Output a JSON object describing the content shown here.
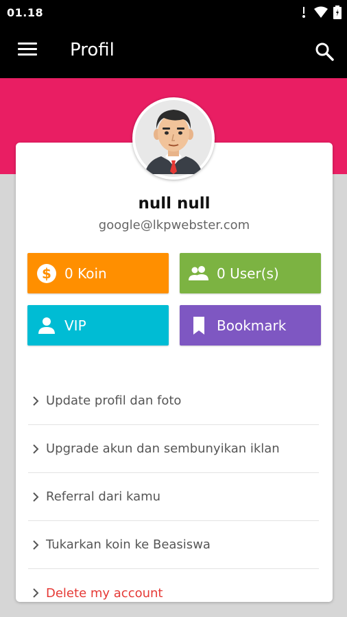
{
  "status_bar": {
    "time": "01.18",
    "icons": [
      "notification-icon",
      "wifi-icon",
      "battery-icon"
    ]
  },
  "app_bar": {
    "title": "Profil",
    "menu_icon": "hamburger-menu-icon",
    "search_icon": "search-icon"
  },
  "colors": {
    "banner": "#e91e63",
    "koin": "#ff8f00",
    "users": "#7cb342",
    "vip": "#00bcd4",
    "bookmark": "#7e57c2",
    "danger": "#e53935"
  },
  "profile": {
    "name": "null null",
    "email": "google@lkpwebster.com"
  },
  "tiles": {
    "koin": {
      "label": "0 Koin",
      "icon": "coin-dollar-icon"
    },
    "users": {
      "label": "0 User(s)",
      "icon": "people-icon"
    },
    "vip": {
      "label": "VIP",
      "icon": "person-icon"
    },
    "bookmark": {
      "label": "Bookmark",
      "icon": "bookmark-icon"
    }
  },
  "menu": [
    {
      "label": "Update profil dan foto"
    },
    {
      "label": "Upgrade akun dan sembunyikan iklan"
    },
    {
      "label": "Referral dari kamu"
    },
    {
      "label": "Tukarkan koin ke Beasiswa"
    },
    {
      "label": "Delete my account"
    }
  ]
}
